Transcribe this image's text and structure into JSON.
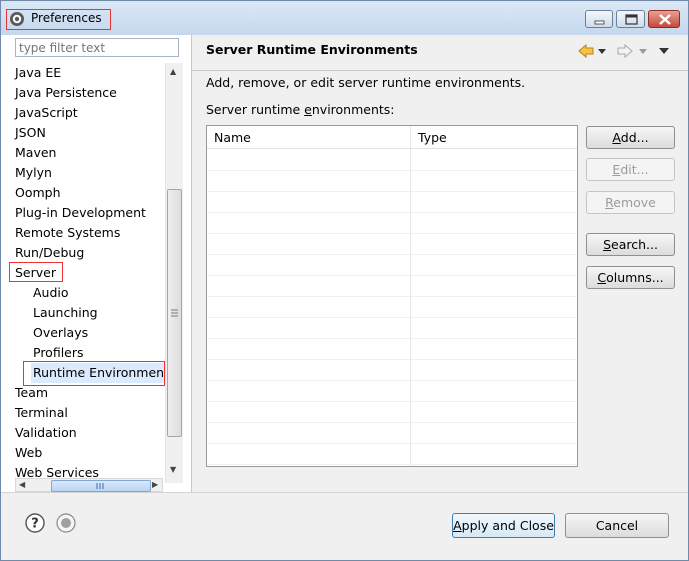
{
  "window": {
    "title": "Preferences"
  },
  "left_panel": {
    "filter_placeholder": "type filter text",
    "tree_items": [
      {
        "label": "Java EE",
        "level": 0
      },
      {
        "label": "Java Persistence",
        "level": 0
      },
      {
        "label": "JavaScript",
        "level": 0
      },
      {
        "label": "JSON",
        "level": 0
      },
      {
        "label": "Maven",
        "level": 0
      },
      {
        "label": "Mylyn",
        "level": 0
      },
      {
        "label": "Oomph",
        "level": 0
      },
      {
        "label": "Plug-in Development",
        "level": 0
      },
      {
        "label": "Remote Systems",
        "level": 0
      },
      {
        "label": "Run/Debug",
        "level": 0
      },
      {
        "label": "Server",
        "level": 0
      },
      {
        "label": "Audio",
        "level": 1
      },
      {
        "label": "Launching",
        "level": 1
      },
      {
        "label": "Overlays",
        "level": 1
      },
      {
        "label": "Profilers",
        "level": 1
      },
      {
        "label": "Runtime Environments",
        "level": 1,
        "selected": true
      },
      {
        "label": "Team",
        "level": 0
      },
      {
        "label": "Terminal",
        "level": 0
      },
      {
        "label": "Validation",
        "level": 0
      },
      {
        "label": "Web",
        "level": 0
      },
      {
        "label": "Web Services",
        "level": 0
      }
    ]
  },
  "right_panel": {
    "heading": "Server Runtime Environments",
    "description": "Add, remove, or edit server runtime environments.",
    "list_label": "Server runtime environments:",
    "table": {
      "columns": [
        "Name",
        "Type"
      ],
      "rows": []
    },
    "buttons": {
      "add": "Add...",
      "edit": "Edit...",
      "remove": "Remove",
      "search": "Search...",
      "columns": "Columns..."
    }
  },
  "footer": {
    "apply_close": "Apply and Close",
    "cancel": "Cancel"
  },
  "colors": {
    "titlebar": "#c5d7ee",
    "highlight_box": "#ee3333",
    "selection": "#dbeaff",
    "nav_arrow": "#e8a317"
  }
}
